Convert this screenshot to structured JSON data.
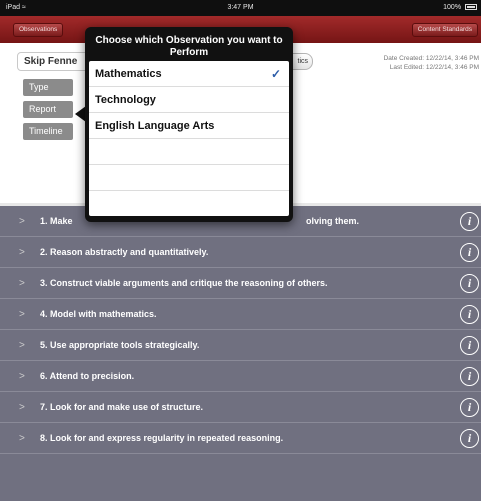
{
  "status_bar": {
    "device": "iPad",
    "time": "3:47 PM",
    "battery": "100%"
  },
  "nav_bar": {
    "left_button": "Observations",
    "right_button": "Content Standards"
  },
  "form": {
    "teacher_name": "Skip Fenne",
    "subject_chip": "tics",
    "date_created": "Date Created: 12/22/14, 3:46 PM",
    "last_edited": "Last Edited: 12/22/14, 3:46 PM",
    "side_buttons": [
      "Type",
      "Report",
      "Timeline"
    ]
  },
  "popover": {
    "title": "Choose which Observation you want to Perform",
    "options": [
      "Mathematics",
      "Technology",
      "English Language Arts"
    ],
    "selected_option": "Mathematics",
    "check_symbol": "✓"
  },
  "standards": [
    {
      "full": "1. Make sense of problems and persevere in solving them.",
      "left": "1. Make",
      "right": "olving them."
    },
    "2. Reason abstractly and quantitatively.",
    "3. Construct viable arguments and critique the reasoning of others.",
    "4. Model with mathematics.",
    "5. Use appropriate tools strategically.",
    "6. Attend to precision.",
    "7. Look for and make use of structure.",
    "8. Look for and express regularity in repeated reasoning."
  ],
  "icons": {
    "chevron": "chevron-right-icon",
    "info": "info-icon",
    "wifi": "wifi-icon",
    "battery": "battery-icon"
  },
  "colors": {
    "nav_red": "#8a1e1e",
    "list_background": "#707080",
    "popover_black": "#111111",
    "check_blue": "#2c5ca8"
  }
}
